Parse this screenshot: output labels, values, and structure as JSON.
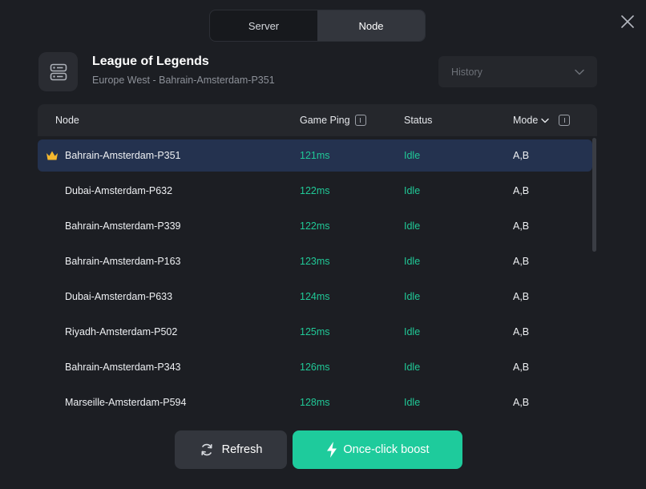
{
  "tabs": [
    {
      "label": "Server",
      "active": false
    },
    {
      "label": "Node",
      "active": true
    }
  ],
  "header": {
    "title": "League of Legends",
    "subtitle": "Europe West - Bahrain-Amsterdam-P351",
    "icon": "server-icon"
  },
  "history": {
    "placeholder": "History",
    "icon": "chevron-down-icon"
  },
  "table": {
    "columns": {
      "node": "Node",
      "ping": "Game Ping",
      "status": "Status",
      "mode": "Mode"
    },
    "rows": [
      {
        "node": "Bahrain-Amsterdam-P351",
        "ping": "121ms",
        "status": "Idle",
        "mode": "A,B",
        "selected": true
      },
      {
        "node": "Dubai-Amsterdam-P632",
        "ping": "122ms",
        "status": "Idle",
        "mode": "A,B"
      },
      {
        "node": "Bahrain-Amsterdam-P339",
        "ping": "122ms",
        "status": "Idle",
        "mode": "A,B"
      },
      {
        "node": "Bahrain-Amsterdam-P163",
        "ping": "123ms",
        "status": "Idle",
        "mode": "A,B"
      },
      {
        "node": "Dubai-Amsterdam-P633",
        "ping": "124ms",
        "status": "Idle",
        "mode": "A,B"
      },
      {
        "node": "Riyadh-Amsterdam-P502",
        "ping": "125ms",
        "status": "Idle",
        "mode": "A,B"
      },
      {
        "node": "Bahrain-Amsterdam-P343",
        "ping": "126ms",
        "status": "Idle",
        "mode": "A,B"
      },
      {
        "node": "Marseille-Amsterdam-P594",
        "ping": "128ms",
        "status": "Idle",
        "mode": "A,B"
      }
    ]
  },
  "buttons": {
    "refresh": "Refresh",
    "boost": "Once-click boost"
  },
  "colors": {
    "accent": "#1ecb9c",
    "ping": "#20c997",
    "selected_row": "#24324f",
    "crown": "#f5b82e"
  }
}
